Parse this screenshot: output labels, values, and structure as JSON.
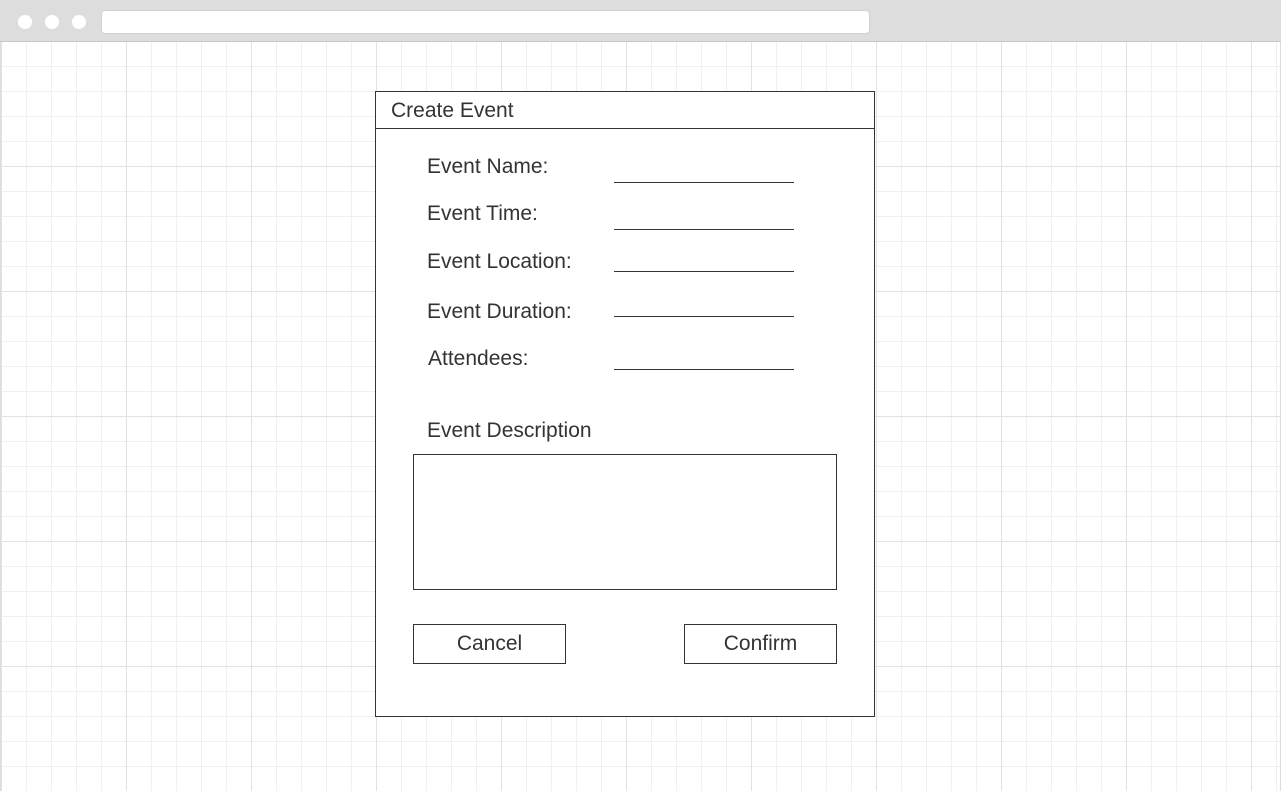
{
  "dialog": {
    "title": "Create Event",
    "fields": [
      {
        "label": "Event Name:",
        "value": ""
      },
      {
        "label": "Event Time:",
        "value": ""
      },
      {
        "label": "Event Location:",
        "value": ""
      },
      {
        "label": "Event Duration:",
        "value": ""
      },
      {
        "label": "Attendees:",
        "value": ""
      }
    ],
    "description": {
      "label": "Event Description",
      "value": ""
    },
    "buttons": {
      "cancel_label": "Cancel",
      "confirm_label": "Confirm"
    }
  }
}
